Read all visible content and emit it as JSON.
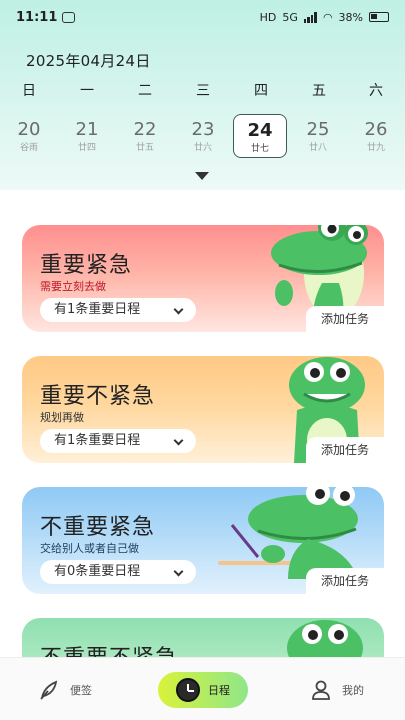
{
  "status_bar": {
    "time": "11:11",
    "network": "HD",
    "signal": "5G",
    "battery": "38%"
  },
  "calendar": {
    "date_title": "2025年04月24日",
    "weekdays": [
      "日",
      "一",
      "二",
      "三",
      "四",
      "五",
      "六"
    ],
    "days": [
      {
        "num": "20",
        "lunar": "谷雨"
      },
      {
        "num": "21",
        "lunar": "廿四"
      },
      {
        "num": "22",
        "lunar": "廿五"
      },
      {
        "num": "23",
        "lunar": "廿六"
      },
      {
        "num": "24",
        "lunar": "廿七"
      },
      {
        "num": "25",
        "lunar": "廿八"
      },
      {
        "num": "26",
        "lunar": "廿九"
      }
    ],
    "selected_index": 4
  },
  "cards": [
    {
      "title": "重要紧急",
      "subtitle": "需要立刻去做",
      "schedule": "有1条重要日程",
      "add": "添加任务"
    },
    {
      "title": "重要不紧急",
      "subtitle": "规划再做",
      "schedule": "有1条重要日程",
      "add": "添加任务"
    },
    {
      "title": "不重要紧急",
      "subtitle": "交给别人或者自己做",
      "schedule": "有0条重要日程",
      "add": "添加任务"
    },
    {
      "title": "不重要不紧急",
      "subtitle": "",
      "schedule": "",
      "add": ""
    }
  ],
  "nav": {
    "memo": "便签",
    "schedule": "日程",
    "mine": "我的"
  },
  "colors": {
    "urgent_important": "#ff8f8f",
    "important": "#ffc985",
    "urgent": "#8fc9f5",
    "neither": "#8fe0b0",
    "mascot_green": "#4cc064",
    "nav_active": "#d9f23a"
  }
}
